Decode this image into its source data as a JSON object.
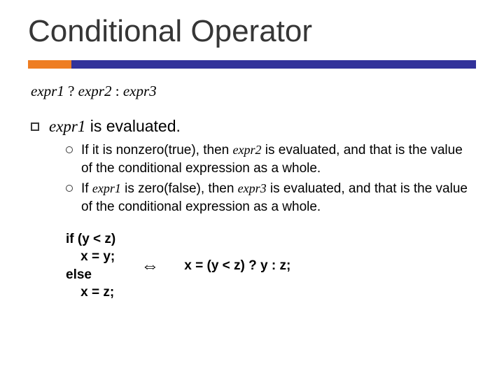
{
  "title": "Conditional Operator",
  "syntax": {
    "e1": "expr1",
    "q": " ? ",
    "e2": "expr2",
    "c": " : ",
    "e3": "expr3"
  },
  "bullet": {
    "e1": "expr1",
    "rest": " is evaluated."
  },
  "sub1": {
    "pre": "If it is nonzero(true), then ",
    "e2": "expr2",
    "post": " is evaluated, and that is the value of the conditional expression as a whole."
  },
  "sub2": {
    "pre": "If ",
    "e1": "expr1",
    "mid": " is zero(false), then ",
    "e3": "expr3",
    "post": " is evaluated, and that is the value of the conditional expression as a whole."
  },
  "code_if": "if (y < z)\n    x = y;\nelse\n    x = z;",
  "arrow": "⇔",
  "code_ternary": "x = (y < z) ? y : z;"
}
